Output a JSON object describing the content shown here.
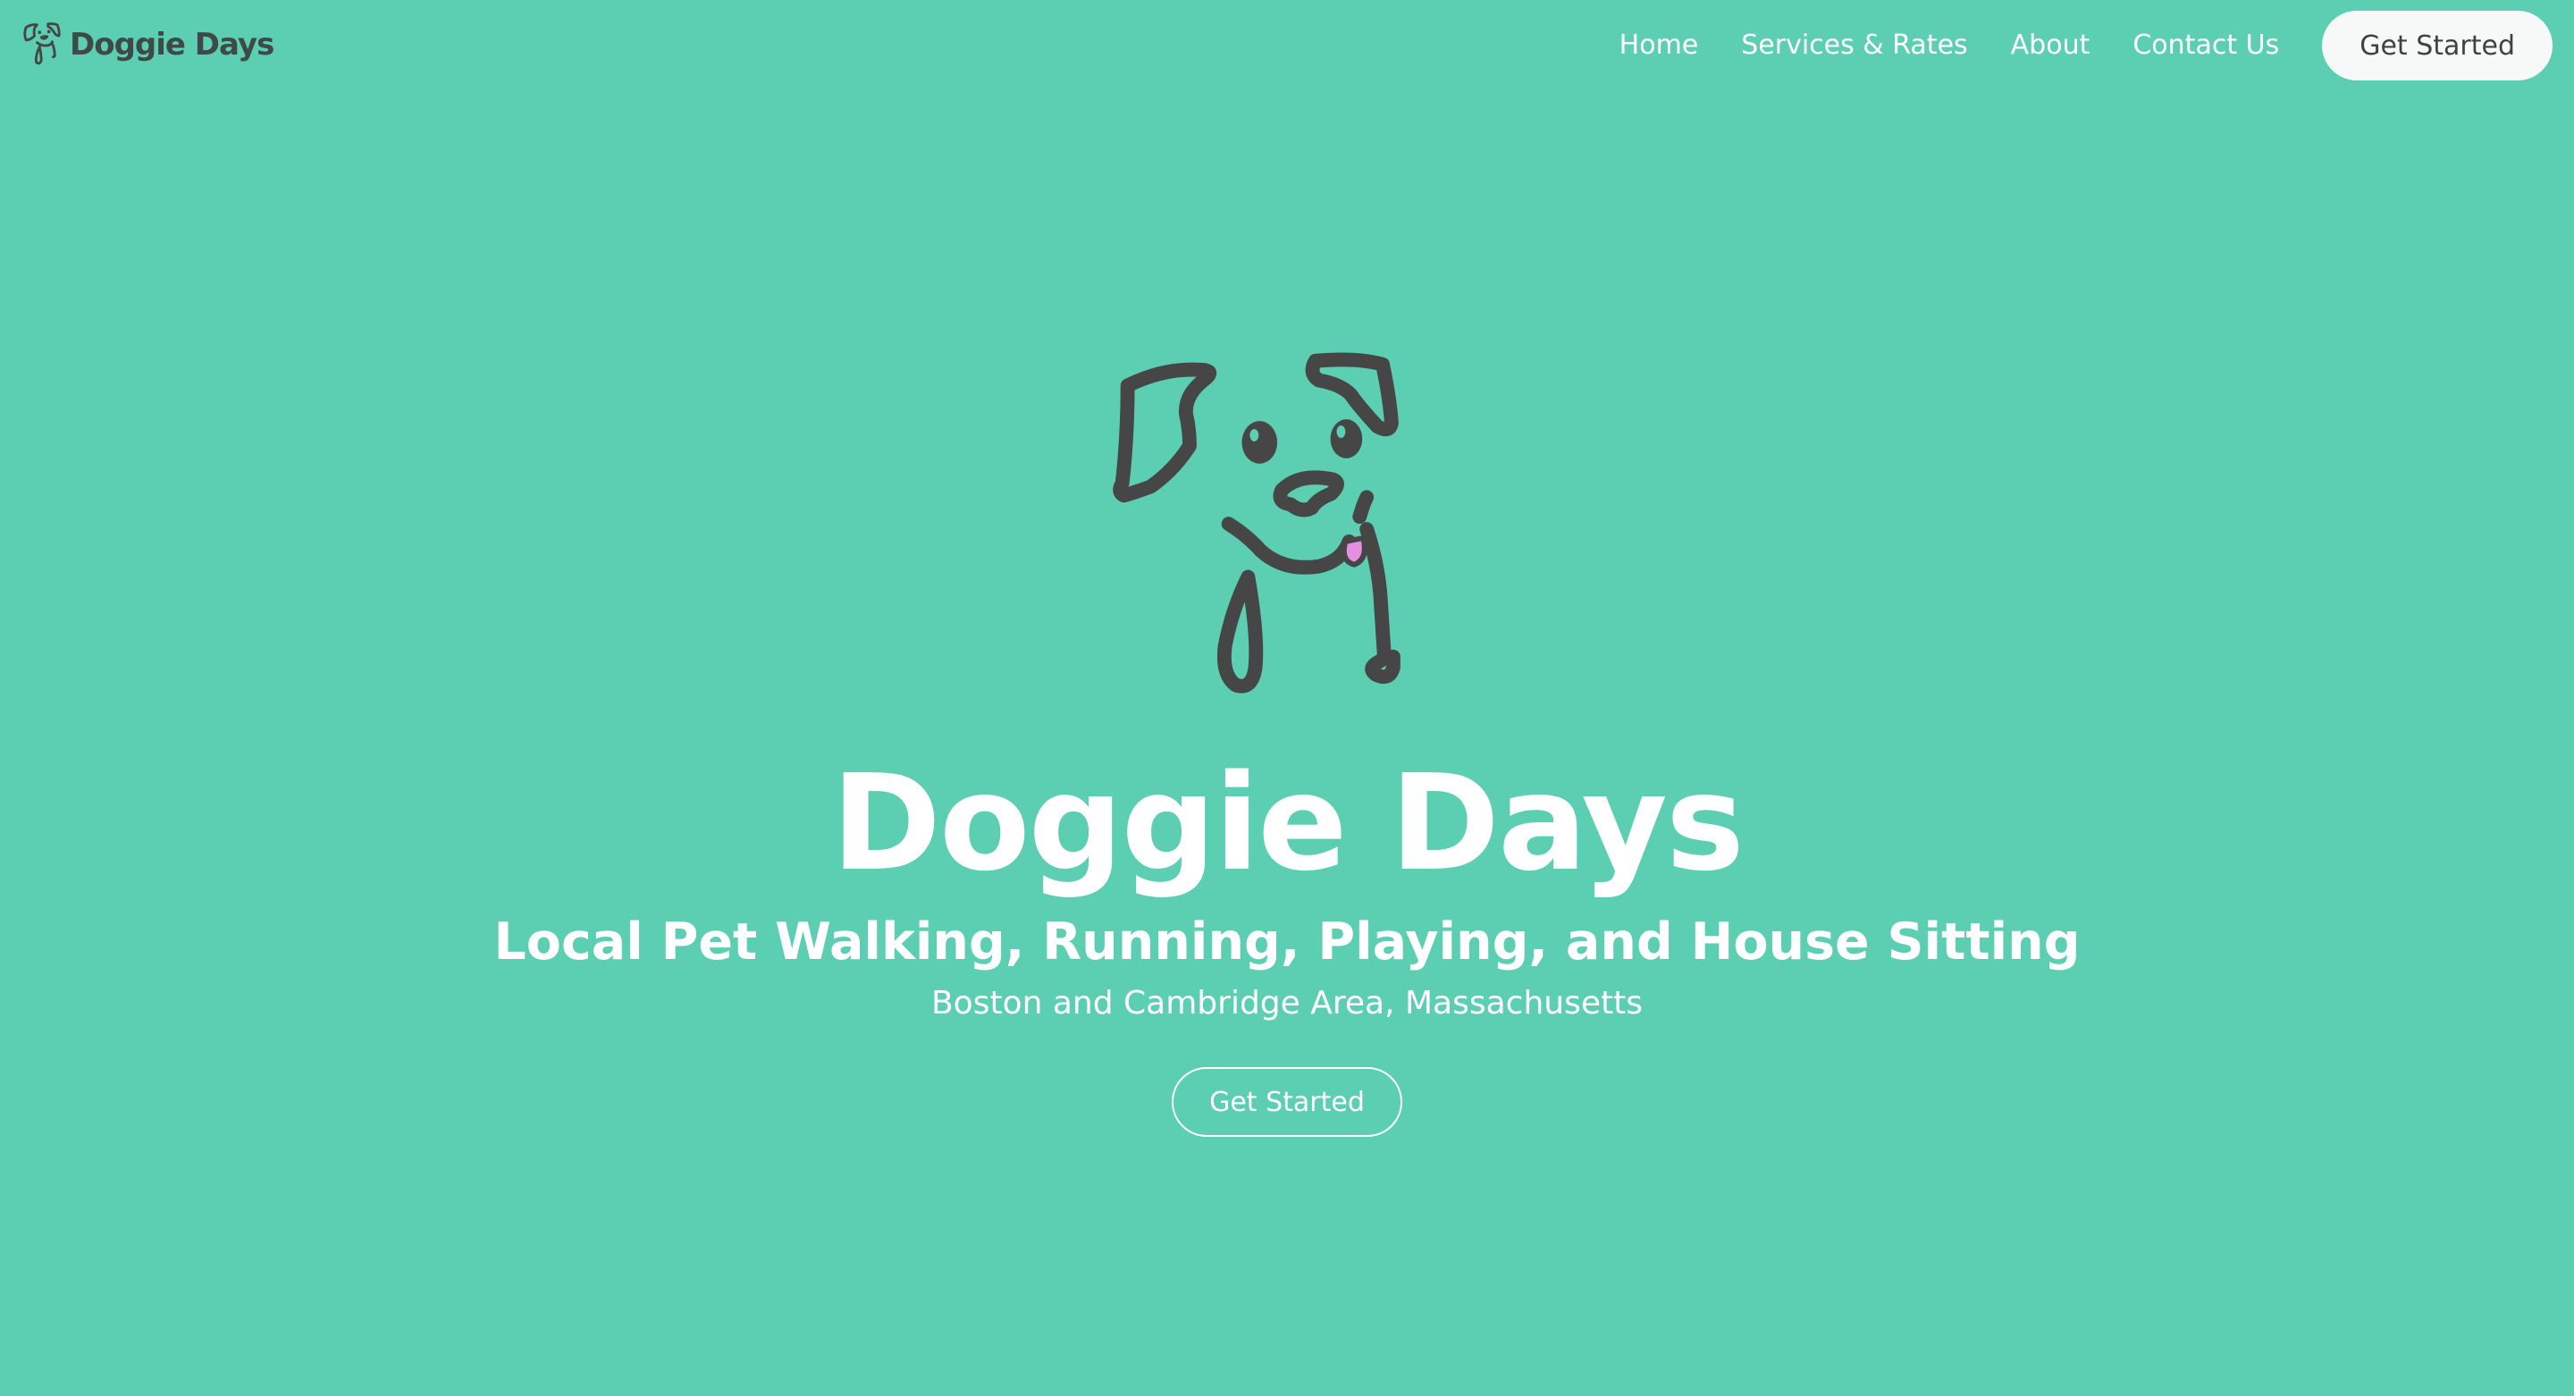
{
  "brand": {
    "name": "Doggie Days",
    "logo_icon": "dog-face-icon"
  },
  "nav": {
    "links": [
      {
        "label": "Home"
      },
      {
        "label": "Services & Rates"
      },
      {
        "label": "About"
      },
      {
        "label": "Contact Us"
      }
    ],
    "cta_label": "Get Started"
  },
  "hero": {
    "illustration_icon": "dog-face-icon",
    "title": "Doggie Days",
    "subtitle": "Local Pet Walking, Running, Playing, and House Sitting",
    "location": "Boston and Cambridge Area, Massachusetts",
    "cta_label": "Get Started"
  },
  "colors": {
    "background": "#5ccfb2",
    "line_art": "#464646",
    "tongue": "#e58fe0",
    "text_light": "#ffffff",
    "button_light": "#f7f8f8",
    "button_dark_text": "#3c4442"
  }
}
